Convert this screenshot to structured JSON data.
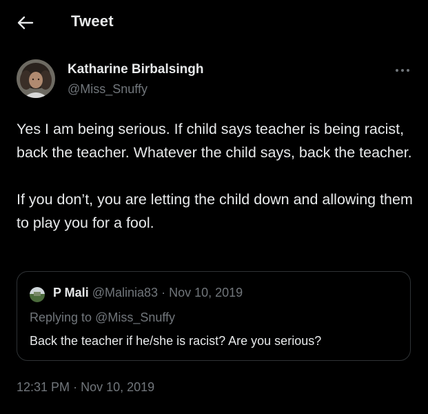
{
  "header": {
    "title": "Tweet",
    "back_icon": "arrow-left-icon"
  },
  "author": {
    "name": "Katharine Birbalsingh",
    "handle": "@Miss_Snuffy",
    "more_icon": "more-horizontal-icon"
  },
  "tweet": {
    "paragraphs": [
      "Yes I am being serious. If child says teacher is being racist, back the teacher. Whatever the child says, back the teacher.",
      "If you don’t, you are letting the child down and allowing them to play you for a fool."
    ]
  },
  "quote": {
    "name": "P Mali",
    "handle": "@Malinia83",
    "separator": "·",
    "date": "Nov 10, 2019",
    "replying_prefix": "Replying to ",
    "replying_to": "@Miss_Snuffy",
    "text": "Back the teacher if he/she is racist? Are you serious?"
  },
  "timestamp": {
    "time": "12:31 PM",
    "separator": "·",
    "date": "Nov 10, 2019"
  },
  "colors": {
    "background": "#000000",
    "text_primary": "#e7e9ea",
    "text_secondary": "#71767b",
    "border": "#2f3336"
  }
}
